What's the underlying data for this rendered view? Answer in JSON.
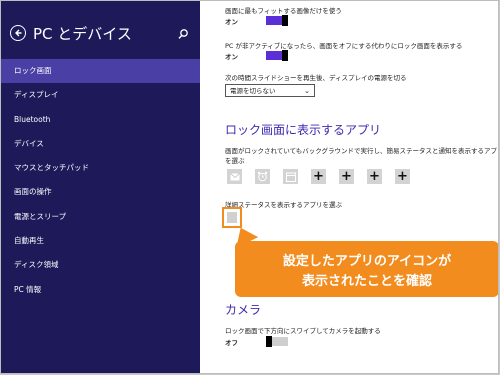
{
  "header": {
    "title": "PC とデバイス"
  },
  "sidebar": {
    "items": [
      {
        "label": "ロック画面"
      },
      {
        "label": "ディスプレイ"
      },
      {
        "label": "Bluetooth"
      },
      {
        "label": "デバイス"
      },
      {
        "label": "マウスとタッチパッド"
      },
      {
        "label": "画面の操作"
      },
      {
        "label": "電源とスリープ"
      },
      {
        "label": "自動再生"
      },
      {
        "label": "ディスク領域"
      },
      {
        "label": "PC 情報"
      }
    ]
  },
  "main": {
    "fit_image_label": "画面に最もフィットする画像だけを使う",
    "fit_image_state": "オン",
    "inactive_label": "PC が非アクティブになったら、画面をオフにする代わりにロック画面を表示する",
    "inactive_state": "オン",
    "slideshow_label": "次の時間スライドショーを再生後、ディスプレイの電源を切る",
    "slideshow_value": "電源を切らない",
    "lockapps_heading": "ロック画面に表示するアプリ",
    "lockapps_desc_1": "画面がロックされていてもバックグラウンドで実行し、簡易ステータスと通知を表示するアプリ",
    "lockapps_desc_2": "を選ぶ",
    "add_symbol": "+",
    "detailed_status_label": "詳細ステータスを表示するアプリを選ぶ",
    "camera_heading": "カメラ",
    "camera_label": "ロック画面で下方向にスワイプしてカメラを起動する",
    "camera_state": "オフ"
  },
  "callout": {
    "line1": "設定したアプリのアイコンが",
    "line2": "表示されたことを確認"
  },
  "colors": {
    "sidebar_bg": "#1e1a5a",
    "sidebar_active": "#4a3fa4",
    "accent": "#5a2fd8",
    "heading": "#3b2bb0",
    "callout": "#f28c1e"
  }
}
